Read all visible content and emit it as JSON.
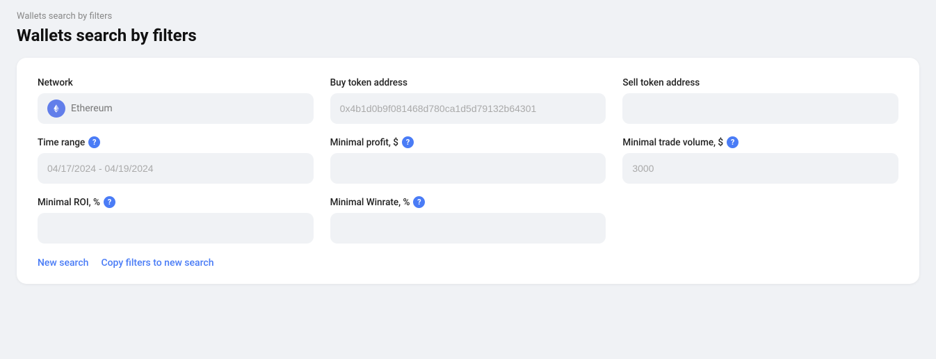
{
  "breadcrumb": "Wallets search by filters",
  "page_title": "Wallets search by filters",
  "card": {
    "fields": [
      {
        "id": "network",
        "label": "Network",
        "type": "network",
        "placeholder": "Ethereum",
        "value": "",
        "has_help": false
      },
      {
        "id": "buy_token_address",
        "label": "Buy token address",
        "type": "text",
        "placeholder": "0x4b1d0b9f081468d780ca1d5d79132b64301",
        "value": "",
        "has_help": false
      },
      {
        "id": "sell_token_address",
        "label": "Sell token address",
        "type": "text",
        "placeholder": "",
        "value": "",
        "has_help": false
      },
      {
        "id": "time_range",
        "label": "Time range",
        "type": "text",
        "placeholder": "04/17/2024 - 04/19/2024",
        "value": "",
        "has_help": true
      },
      {
        "id": "minimal_profit",
        "label": "Minimal profit, $",
        "type": "text",
        "placeholder": "",
        "value": "",
        "has_help": true
      },
      {
        "id": "minimal_trade_volume",
        "label": "Minimal trade volume, $",
        "type": "text",
        "placeholder": "3000",
        "value": "",
        "has_help": true
      },
      {
        "id": "minimal_roi",
        "label": "Minimal ROI, %",
        "type": "text",
        "placeholder": "",
        "value": "",
        "has_help": true
      },
      {
        "id": "minimal_winrate",
        "label": "Minimal Winrate, %",
        "type": "text",
        "placeholder": "",
        "value": "",
        "has_help": true
      }
    ],
    "actions": [
      {
        "id": "new_search",
        "label": "New search"
      },
      {
        "id": "copy_filters",
        "label": "Copy filters to new search"
      }
    ]
  },
  "help_label": "?",
  "colors": {
    "accent": "#4a7cf6",
    "eth_bg": "#627eea"
  }
}
